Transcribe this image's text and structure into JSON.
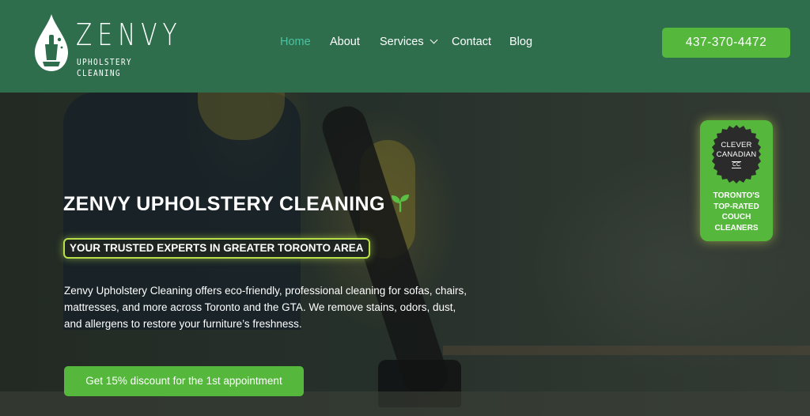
{
  "brand": {
    "name": "ZENVY",
    "tagline": "UPHOLSTERY CLEANING"
  },
  "nav": {
    "items": [
      {
        "label": "Home",
        "active": true
      },
      {
        "label": "About"
      },
      {
        "label": "Services",
        "has_dropdown": true
      },
      {
        "label": "Contact"
      },
      {
        "label": "Blog"
      }
    ]
  },
  "header": {
    "phone_label": "437-370-4472"
  },
  "hero": {
    "title": "ZENVY UPHOLSTERY CLEANING",
    "title_icon": "sprout-icon",
    "tagline": "YOUR TRUSTED EXPERTS IN GREATER TORONTO AREA",
    "description": "Zenvy Upholstery Cleaning offers eco-friendly, professional cleaning for sofas, chairs, mattresses, and more across Toronto and the GTA. We remove stains, odors, dust, and allergens to restore your furniture’s freshness.",
    "cta_label": "Get 15% discount for the 1st appointment"
  },
  "badge": {
    "seal_line1": "CLEVER",
    "seal_line2": "CANADIAN",
    "seal_mark": "CC",
    "text_line1": "TORONTO'S",
    "text_line2": "TOP-RATED",
    "text_line3": "COUCH",
    "text_line4": "CLEANERS"
  },
  "colors": {
    "header_bg": "#2e6e4c",
    "accent_green": "#55b83c",
    "nav_active": "#4bc3a0",
    "tagline_glow": "#b8e04a"
  }
}
